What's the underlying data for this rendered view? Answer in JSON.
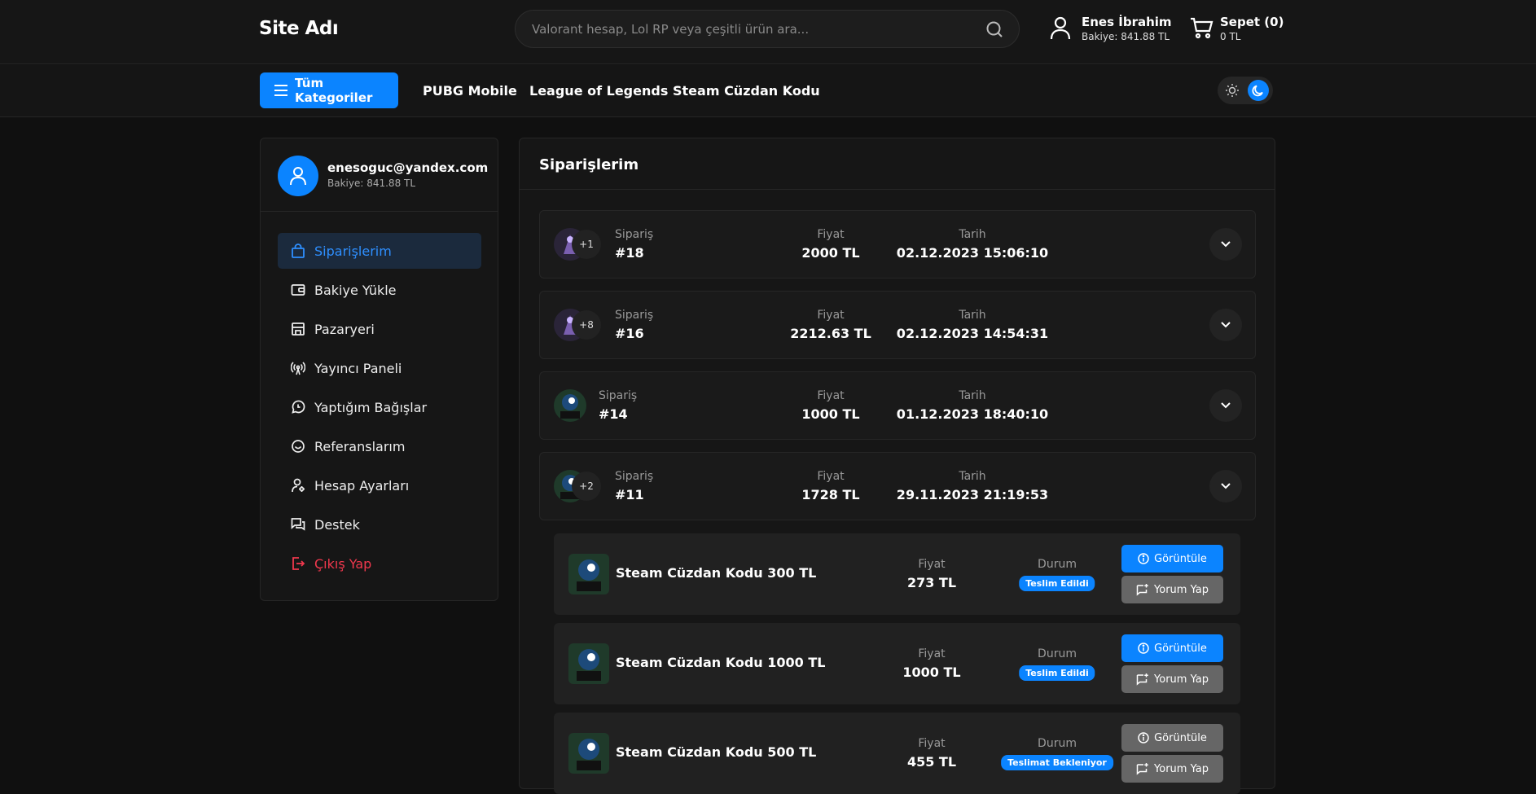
{
  "header": {
    "logo": "Site Adı",
    "search_placeholder": "Valorant hesap, Lol RP veya çeşitli ürün ara...",
    "user_name": "Enes İbrahim",
    "user_balance": "Bakiye: 841.88 TL",
    "cart_label": "Sepet (0)",
    "cart_total": "0 TL"
  },
  "nav": {
    "all_categories": "Tüm Kategoriler",
    "links": [
      "PUBG Mobile",
      "League of Legends",
      "Steam Cüzdan Kodu"
    ]
  },
  "profile": {
    "email": "enesoguc@yandex.com",
    "balance": "Bakiye: 841.88 TL"
  },
  "menu": [
    {
      "label": "Siparişlerim",
      "icon": "shopping-bag-icon"
    },
    {
      "label": "Bakiye Yükle",
      "icon": "wallet-icon"
    },
    {
      "label": "Pazaryeri",
      "icon": "store-icon"
    },
    {
      "label": "Yayıncı Paneli",
      "icon": "broadcast-icon"
    },
    {
      "label": "Yaptığım Bağışlar",
      "icon": "donation-icon"
    },
    {
      "label": "Referanslarım",
      "icon": "smile-icon"
    },
    {
      "label": "Hesap Ayarları",
      "icon": "user-settings-icon"
    },
    {
      "label": "Destek",
      "icon": "chat-icon"
    },
    {
      "label": "Çıkış Yap",
      "icon": "logout-icon"
    }
  ],
  "main": {
    "title": "Siparişlerim",
    "order_label": "Sipariş",
    "price_label": "Fiyat",
    "date_label": "Tarih",
    "status_label": "Durum",
    "orders": [
      {
        "id": "#18",
        "price": "2000 TL",
        "date": "02.12.2023 15:06:10",
        "more": "+1"
      },
      {
        "id": "#16",
        "price": "2212.63 TL",
        "date": "02.12.2023 14:54:31",
        "more": "+8"
      },
      {
        "id": "#14",
        "price": "1000 TL",
        "date": "01.12.2023 18:40:10",
        "more": ""
      },
      {
        "id": "#11",
        "price": "1728 TL",
        "date": "29.11.2023 21:19:53",
        "more": "+2"
      }
    ],
    "items": [
      {
        "name": "Steam Cüzdan Kodu 300 TL",
        "price": "273 TL",
        "status": "Teslim Edildi"
      },
      {
        "name": "Steam Cüzdan Kodu 1000 TL",
        "price": "1000 TL",
        "status": "Teslim Edildi"
      },
      {
        "name": "Steam Cüzdan Kodu 500 TL",
        "price": "455 TL",
        "status": "Teslimat Bekleniyor"
      }
    ],
    "view_button": "Görüntüle",
    "review_button": "Yorum Yap"
  },
  "colors": {
    "accent": "#0b84ff",
    "logout": "#f0384d",
    "background": "#101010",
    "panel": "#161616"
  }
}
